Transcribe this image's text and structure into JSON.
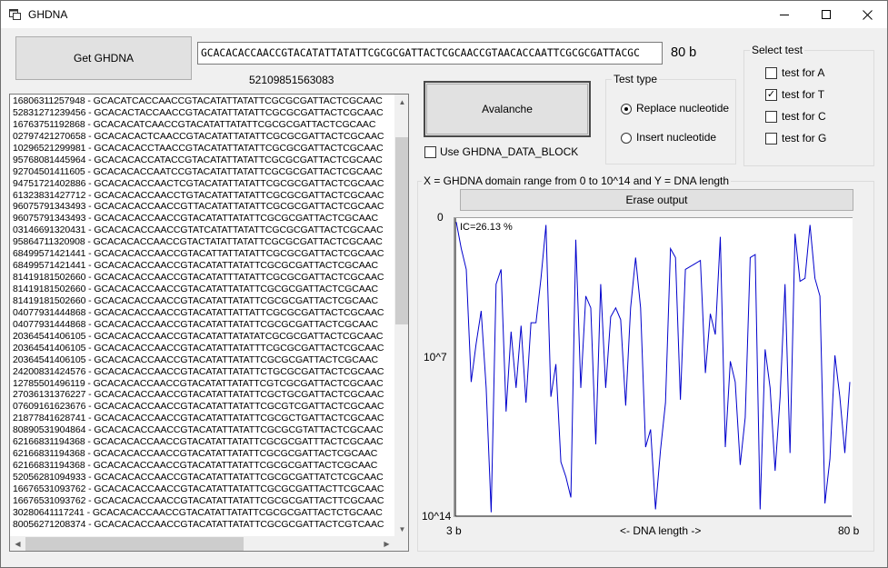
{
  "window": {
    "title": "GHDNA"
  },
  "get_button": {
    "label": "Get GHDNA"
  },
  "dna_field": {
    "value": "GCACACACCAACCGTACATATTATATTCGCGCGATTACTCGCAACCGTAACACCAATTCGCGCGATTACGC"
  },
  "dna_length": "80 b",
  "index_number": "52109851563083",
  "avalanche_button": {
    "label": "Avalanche"
  },
  "use_block": {
    "label": "Use GHDNA_DATA_BLOCK",
    "checked": false
  },
  "test_type": {
    "title": "Test type",
    "options": [
      {
        "label": "Replace nucleotide",
        "selected": true
      },
      {
        "label": "Insert nucleotide",
        "selected": false
      }
    ]
  },
  "select_test": {
    "title": "Select test",
    "options": [
      {
        "label": "test for A",
        "checked": false
      },
      {
        "label": "test for T",
        "checked": true
      },
      {
        "label": "test for C",
        "checked": false
      },
      {
        "label": "test for G",
        "checked": false
      }
    ]
  },
  "chart_section": {
    "title": "X = GHDNA domain range from 0 to 10^14 and Y = DNA length"
  },
  "erase_button": {
    "label": "Erase output"
  },
  "list": [
    "16806311257948 - GCACATCACCAACCGTACATATTATATTCGCGCGATTACTCGCAAC",
    "52831271239456 - GCACACTACCAACCGTACATATTATATTCGCGCGATTACTCGCAAC",
    "16763751192868 - GCACACATCAACCGTACATATTATATTCGCGCGATTACTCGCAAC",
    "02797421270658 - GCACACACTCAACCGTACATATTATATTCGCGCGATTACTCGCAAC",
    "10296521299981 - GCACACACCTAACCGTACATATTATATTCGCGCGATTACTCGCAAC",
    "95768081445964 - GCACACACCATACCGTACATATTATATTCGCGCGATTACTCGCAAC",
    "92704501411605 - GCACACACCAATCCGTACATATTATATTCGCGCGATTACTCGCAAC",
    "94751721402886 - GCACACACCAACTCGTACATATTATATTCGCGCGATTACTCGCAAC",
    "61323831427712 - GCACACACCAACCTGTACATATTATATTCGCGCGATTACTCGCAAC",
    "96075791343493 - GCACACACCAACCGTTACATATTATATTCGCGCGATTACTCGCAAC",
    "96075791343493 - GCACACACCAACCGTACATATTATATTCGCGCGATTACTCGCAAC",
    "03146691320431 - GCACACACCAACCGTATCATATTATATTCGCGCGATTACTCGCAAC",
    "95864711320908 - GCACACACCAACCGTACTATATTATATTCGCGCGATTACTCGCAAC",
    "68499571421441 - GCACACACCAACCGTACATTATTATATTCGCGCGATTACTCGCAAC",
    "68499571421441 - GCACACACCAACCGTACATATTATATTCGCGCGATTACTCGCAAC",
    "81419181502660 - GCACACACCAACCGTACATATTTATATTCGCGCGATTACTCGCAAC",
    "81419181502660 - GCACACACCAACCGTACATATTATATTCGCGCGATTACTCGCAAC",
    "81419181502660 - GCACACACCAACCGTACATATTATATTCGCGCGATTACTCGCAAC",
    "04077931444868 - GCACACACCAACCGTACATATTATTATTCGCGCGATTACTCGCAAC",
    "04077931444868 - GCACACACCAACCGTACATATTATATTCGCGCGATTACTCGCAAC",
    "20364541406105 - GCACACACCAACCGTACATATTATATATCGCGCGATTACTCGCAAC",
    "20364541406105 - GCACACACCAACCGTACATATTATATTTCGCGCGATTACTCGCAAC",
    "20364541406105 - GCACACACCAACCGTACATATTATATTCGCGCGATTACTCGCAAC",
    "24200831424576 - GCACACACCAACCGTACATATTATATTCTGCGCGATTACTCGCAAC",
    "12785501496119 - GCACACACCAACCGTACATATTATATTCGTCGCGATTACTCGCAAC",
    "27036131376227 - GCACACACCAACCGTACATATTATATTCGCTGCGATTACTCGCAAC",
    "07609161623676 - GCACACACCAACCGTACATATTATATTCGCGTCGATTACTCGCAAC",
    "21877841628741 - GCACACACCAACCGTACATATTATATTCGCGCTGATTACTCGCAAC",
    "80890531904864 - GCACACACCAACCGTACATATTATATTCGCGCGTATTACTCGCAAC",
    "62166831194368 - GCACACACCAACCGTACATATTATATTCGCGCGATTTACTCGCAAC",
    "62166831194368 - GCACACACCAACCGTACATATTATATTCGCGCGATTACTCGCAAC",
    "62166831194368 - GCACACACCAACCGTACATATTATATTCGCGCGATTACTCGCAAC",
    "52056281094933 - GCACACACCAACCGTACATATTATATTCGCGCGATTATCTCGCAAC",
    "16676531093762 - GCACACACCAACCGTACATATTATATTCGCGCGATTACTTCGCAAC",
    "16676531093762 - GCACACACCAACCGTACATATTATATTCGCGCGATTACTTCGCAAC",
    "30280641117241 - GCACACACCAACCGTACATATTATATTCGCGCGATTACTCTGCAAC",
    "80056271208374 - GCACACACCAACCGTACATATTATATTCGCGCGATTACTCGTCAAC"
  ],
  "chart_data": {
    "type": "line",
    "title": "",
    "annotation": "IC=26.13 %",
    "xlabel": "<- DNA length ->",
    "x_tick_labels": [
      "3 b",
      "80 b"
    ],
    "y_tick_labels": [
      "0",
      "10^7",
      "10^14"
    ],
    "xlim": [
      3,
      80
    ],
    "ylim_fraction": [
      0,
      1
    ],
    "line_color": "#0000cc",
    "series": [
      {
        "values": [
          0.01,
          0.1,
          0.17,
          0.55,
          0.42,
          0.31,
          0.57,
          0.99,
          0.22,
          0.17,
          0.65,
          0.38,
          0.57,
          0.36,
          0.62,
          0.35,
          0.35,
          0.2,
          0.02,
          0.6,
          0.49,
          0.82,
          0.87,
          0.94,
          0.07,
          0.57,
          0.26,
          0.3,
          0.76,
          0.22,
          0.57,
          0.33,
          0.3,
          0.34,
          0.63,
          0.3,
          0.13,
          0.3,
          0.77,
          0.71,
          0.98,
          0.78,
          0.62,
          0.1,
          0.13,
          0.61,
          0.17,
          0.16,
          0.15,
          0.14,
          0.52,
          0.32,
          0.39,
          0.06,
          0.77,
          0.48,
          0.55,
          0.83,
          0.67,
          0.13,
          0.12,
          0.98,
          0.44,
          0.57,
          0.85,
          0.6,
          0.22,
          0.79,
          0.05,
          0.21,
          0.2,
          0.02,
          0.2,
          0.26,
          0.96,
          0.81,
          0.46,
          0.6,
          0.79,
          0.55
        ]
      }
    ]
  }
}
